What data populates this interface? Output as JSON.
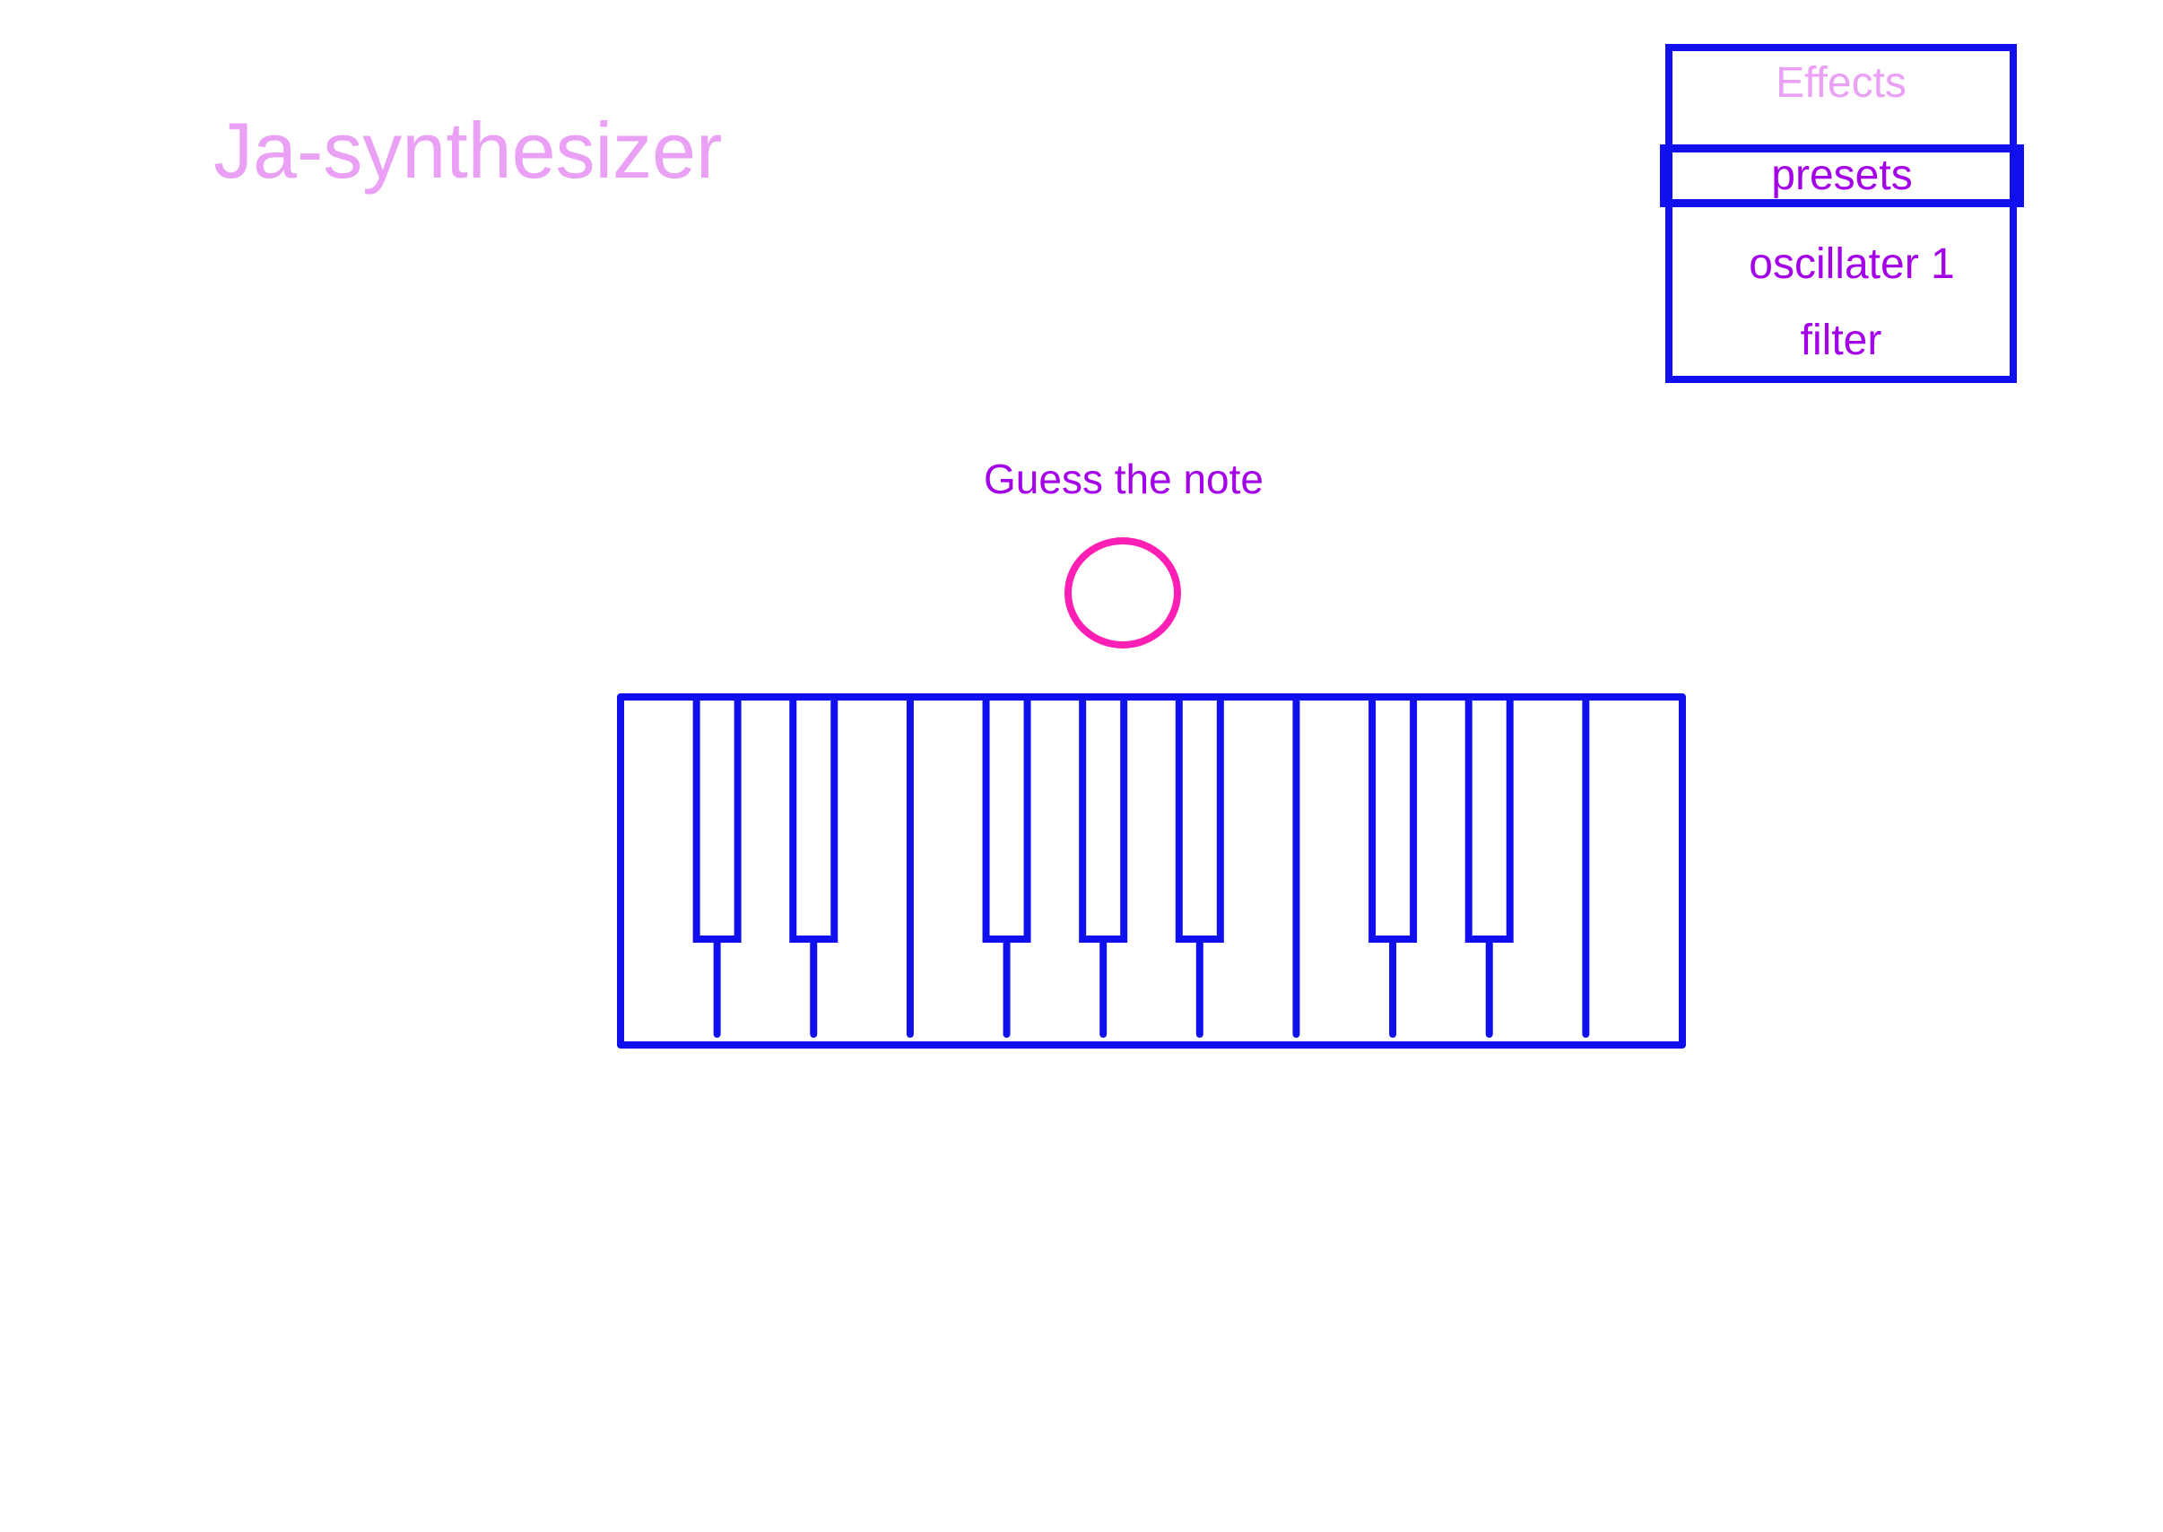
{
  "app": {
    "title": "Ja-synthesizer"
  },
  "menu": {
    "header": "Effects",
    "items": [
      {
        "label": "presets",
        "selected": true
      },
      {
        "label": "oscillater 1",
        "selected": false
      },
      {
        "label": "filter",
        "selected": false
      }
    ]
  },
  "game": {
    "prompt": "Guess the note",
    "answer_indicator": "empty-circle-icon"
  },
  "keyboard": {
    "white_keys": 11,
    "black_key_groups": [
      2,
      3,
      2
    ]
  },
  "colors": {
    "title": "#e9a0f5",
    "accent_text": "#a300e8",
    "outline": "#1010ee",
    "indicator": "#ff1fb4",
    "background": "#ffffff"
  }
}
